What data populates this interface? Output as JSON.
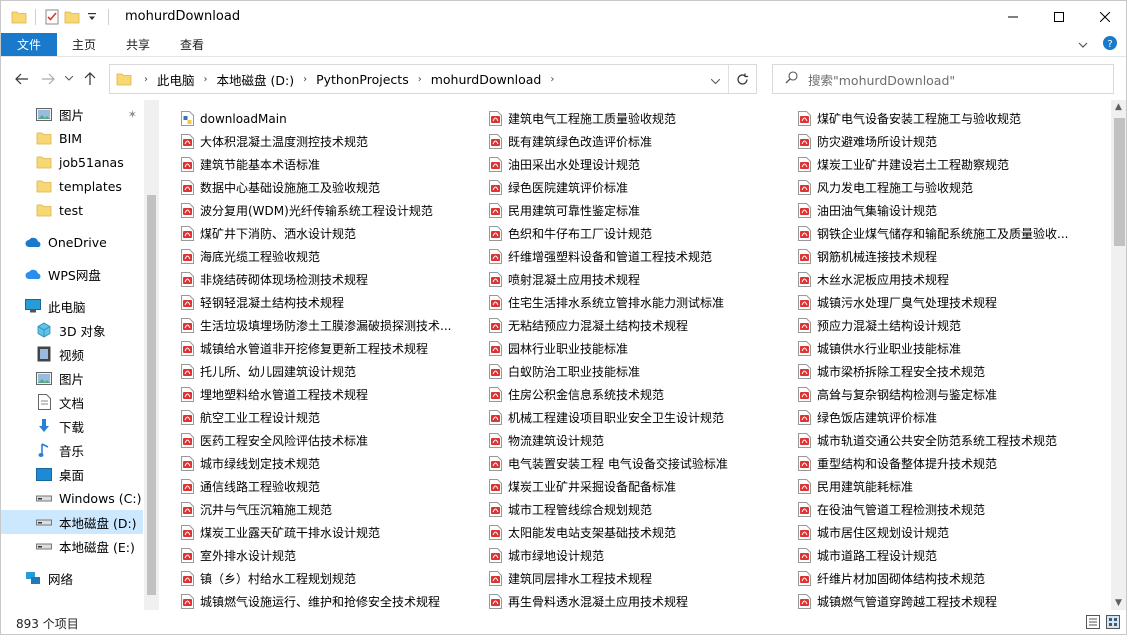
{
  "window": {
    "title": "mohurdDownload",
    "accent": "#1979ca"
  },
  "ribbon": {
    "tabs": [
      "文件",
      "主页",
      "共享",
      "查看"
    ]
  },
  "address": {
    "crumbs": [
      "此电脑",
      "本地磁盘 (D:)",
      "PythonProjects",
      "mohurdDownload"
    ],
    "search_placeholder": "搜索\"mohurdDownload\""
  },
  "sidebar": {
    "items": [
      {
        "label": "图片",
        "icon": "pictures-icon",
        "pinned": true
      },
      {
        "label": "BIM",
        "icon": "folder-icon"
      },
      {
        "label": "job51anas",
        "icon": "folder-icon"
      },
      {
        "label": "templates",
        "icon": "folder-icon"
      },
      {
        "label": "test",
        "icon": "folder-icon"
      },
      {
        "label": "OneDrive",
        "icon": "onedrive-icon"
      },
      {
        "label": "WPS网盘",
        "icon": "wps-cloud-icon"
      },
      {
        "label": "此电脑",
        "icon": "computer-icon"
      },
      {
        "label": "3D 对象",
        "icon": "3d-objects-icon"
      },
      {
        "label": "视频",
        "icon": "videos-icon"
      },
      {
        "label": "图片",
        "icon": "pictures-icon"
      },
      {
        "label": "文档",
        "icon": "documents-icon"
      },
      {
        "label": "下载",
        "icon": "downloads-icon"
      },
      {
        "label": "音乐",
        "icon": "music-icon"
      },
      {
        "label": "桌面",
        "icon": "desktop-icon"
      },
      {
        "label": "Windows  (C:)",
        "icon": "drive-icon"
      },
      {
        "label": "本地磁盘 (D:)",
        "icon": "drive-icon",
        "selected": true
      },
      {
        "label": "本地磁盘 (E:)",
        "icon": "drive-icon"
      },
      {
        "label": "网络",
        "icon": "network-icon"
      }
    ]
  },
  "files": {
    "col1": [
      "downloadMain",
      "大体积混凝土温度测控技术规范",
      "建筑节能基本术语标准",
      "数据中心基础设施施工及验收规范",
      "波分复用(WDM)光纤传输系统工程设计规范",
      "煤矿井下消防、洒水设计规范",
      "海底光缆工程验收规范",
      "非烧结砖砌体现场检测技术规程",
      "轻钢轻混凝土结构技术规程",
      "生活垃圾填埋场防渗土工膜渗漏破损探测技术...",
      "城镇给水管道非开挖修复更新工程技术规程",
      "托儿所、幼儿园建筑设计规范",
      "埋地塑料给水管道工程技术规程",
      "航空工业工程设计规范",
      "医药工程安全风险评估技术标准",
      "城市绿线划定技术规范",
      "通信线路工程验收规范",
      "沉井与气压沉箱施工规范",
      "煤炭工业露天矿疏干排水设计规范",
      "室外排水设计规范",
      "镇（乡）村给水工程规划规范",
      "城镇燃气设施运行、维护和抢修安全技术规程"
    ],
    "col2": [
      "建筑电气工程施工质量验收规范",
      "既有建筑绿色改造评价标准",
      "油田采出水处理设计规范",
      "绿色医院建筑评价标准",
      "民用建筑可靠性鉴定标准",
      "色织和牛仔布工厂设计规范",
      "纤维增强塑料设备和管道工程技术规范",
      "喷射混凝土应用技术规程",
      "住宅生活排水系统立管排水能力测试标准",
      "无粘结预应力混凝土结构技术规程",
      "园林行业职业技能标准",
      "白蚁防治工职业技能标准",
      "住房公积金信息系统技术规范",
      "机械工程建设项目职业安全卫生设计规范",
      "物流建筑设计规范",
      "电气装置安装工程 电气设备交接试验标准",
      "煤炭工业矿井采掘设备配备标准",
      "城市工程管线综合规划规范",
      "太阳能发电站支架基础技术规范",
      "城市绿地设计规范",
      "建筑同层排水工程技术规程",
      "再生骨料透水混凝土应用技术规程"
    ],
    "col3": [
      "煤矿电气设备安装工程施工与验收规范",
      "防灾避难场所设计规范",
      "煤炭工业矿井建设岩土工程勘察规范",
      "风力发电工程施工与验收规范",
      "油田油气集输设计规范",
      "钢铁企业煤气储存和输配系统施工及质量验收...",
      "钢筋机械连接技术规程",
      "木丝水泥板应用技术规程",
      "城镇污水处理厂臭气处理技术规程",
      "预应力混凝土结构设计规范",
      "城镇供水行业职业技能标准",
      "城市梁桥拆除工程安全技术规范",
      "高耸与复杂钢结构检测与鉴定标准",
      "绿色饭店建筑评价标准",
      "城市轨道交通公共安全防范系统工程技术规范",
      "重型结构和设备整体提升技术规范",
      "民用建筑能耗标准",
      "在役油气管道工程检测技术规范",
      "城市居住区规划设计规范",
      "城市道路工程设计规范",
      "纤维片材加固砌体结构技术规范",
      "城镇燃气管道穿跨越工程技术规程"
    ]
  },
  "status": {
    "count_text": "893 个项目"
  }
}
